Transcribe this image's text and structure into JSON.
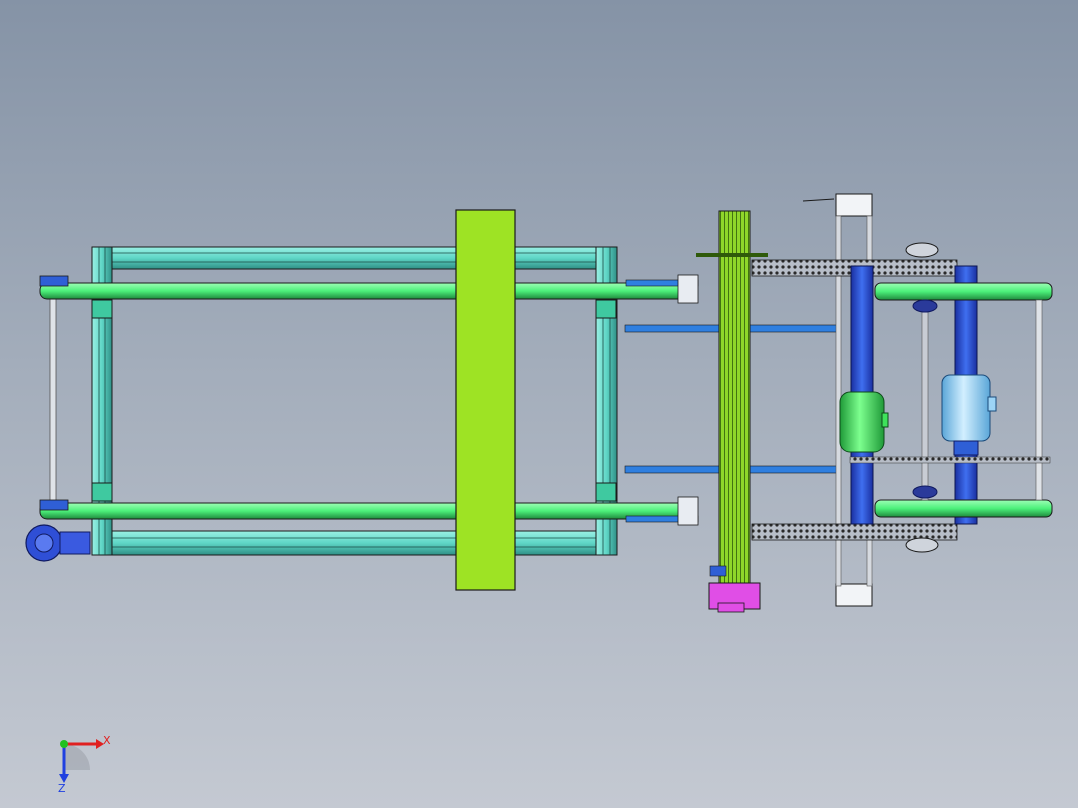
{
  "viewport": {
    "background_top": "#8593a6",
    "background_bottom": "#c4c9d2"
  },
  "colors": {
    "frame_teal": "#5fd6c6",
    "frame_teal_dark": "#2f8f86",
    "rail_green": "#4cf07a",
    "rail_green_dark": "#1f8a3d",
    "panel_lime": "#9ee324",
    "blue_part": "#2f5fd6",
    "blue_dark": "#1a2fa0",
    "bracket_blue": "#2f7fe0",
    "motor_green": "#3ee25a",
    "motor_blue": "#9cd4f6",
    "magenta_part": "#e04ee6",
    "bracket_white": "#f2f4f7",
    "edge_black": "#1a1a1a"
  },
  "triad": {
    "x_label": "X",
    "z_label": "Z",
    "x_color": "#e02020",
    "z_color": "#2040e0",
    "origin_color": "#20c020"
  }
}
